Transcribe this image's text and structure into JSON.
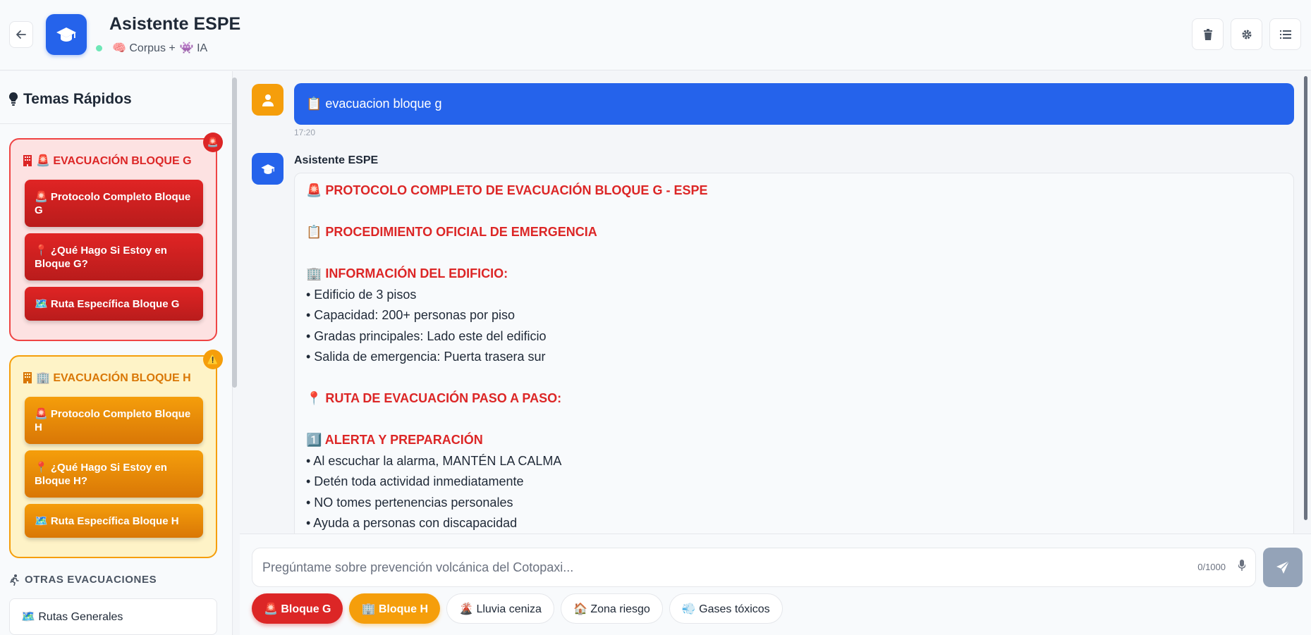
{
  "header": {
    "title": "Asistente ESPE",
    "subtitle_corpus": "🧠 Corpus +",
    "subtitle_ai": "👾 IA",
    "back_icon": "arrow-left-icon",
    "logo_icon": "graduation-cap-icon",
    "actions": [
      "trash-icon",
      "gear-icon",
      "list-icon"
    ]
  },
  "sidebar": {
    "title": "Temas Rápidos",
    "title_icon": "lightbulb-icon",
    "groups": [
      {
        "title": "🚨 EVACUACIÓN BLOQUE G",
        "badge": "🚨",
        "accent": "#dc2626",
        "buttons": [
          "🚨 Protocolo Completo Bloque G",
          "📍 ¿Qué Hago Si Estoy en Bloque G?",
          "🗺️ Ruta Específica Bloque G"
        ]
      },
      {
        "title": "🏢 EVACUACIÓN BLOQUE H",
        "badge": "⚠️",
        "accent": "#f59e0b",
        "buttons": [
          "🚨 Protocolo Completo Bloque H",
          "📍 ¿Qué Hago Si Estoy en Bloque H?",
          "🗺️ Ruta Específica Bloque H"
        ]
      }
    ],
    "other_title": "OTRAS EVACUACIONES",
    "other_items": [
      "🗺️ Rutas Generales"
    ]
  },
  "chat": {
    "user_message": "📋 evacuacion bloque g",
    "user_time": "17:20",
    "bot_name": "Asistente ESPE",
    "bot_lines": [
      {
        "kind": "h",
        "text": "🚨 PROTOCOLO COMPLETO DE EVACUACIÓN BLOQUE G - ESPE"
      },
      {
        "kind": "gap",
        "text": ""
      },
      {
        "kind": "h",
        "text": "📋 PROCEDIMIENTO OFICIAL DE EMERGENCIA"
      },
      {
        "kind": "gap",
        "text": ""
      },
      {
        "kind": "h",
        "text": "🏢 INFORMACIÓN DEL EDIFICIO:"
      },
      {
        "kind": "p",
        "text": "• Edificio de 3 pisos"
      },
      {
        "kind": "p",
        "text": "• Capacidad: 200+ personas por piso"
      },
      {
        "kind": "p",
        "text": "• Gradas principales: Lado este del edificio"
      },
      {
        "kind": "p",
        "text": "• Salida de emergencia: Puerta trasera sur"
      },
      {
        "kind": "gap",
        "text": ""
      },
      {
        "kind": "h",
        "text": "📍 RUTA DE EVACUACIÓN PASO A PASO:"
      },
      {
        "kind": "gap",
        "text": ""
      },
      {
        "kind": "h",
        "text": "1️⃣ ALERTA Y PREPARACIÓN"
      },
      {
        "kind": "p",
        "text": "• Al escuchar la alarma, MANTÉN LA CALMA"
      },
      {
        "kind": "p",
        "text": "• Detén toda actividad inmediatamente"
      },
      {
        "kind": "p",
        "text": "• NO tomes pertenencias personales"
      },
      {
        "kind": "p",
        "text": "• Ayuda a personas con discapacidad"
      }
    ]
  },
  "input": {
    "placeholder": "Pregúntame sobre prevención volcánica del Cotopaxi...",
    "counter": "0/1000"
  },
  "chips": [
    {
      "label": "🚨 Bloque G",
      "style": "red"
    },
    {
      "label": "🏢 Bloque H",
      "style": "amber"
    },
    {
      "label": "🌋 Lluvia ceniza",
      "style": "plain"
    },
    {
      "label": "🏠 Zona riesgo",
      "style": "plain"
    },
    {
      "label": "💨 Gases tóxicos",
      "style": "plain"
    }
  ],
  "colors": {
    "primary": "#2563eb",
    "danger": "#dc2626",
    "warning": "#f59e0b"
  }
}
